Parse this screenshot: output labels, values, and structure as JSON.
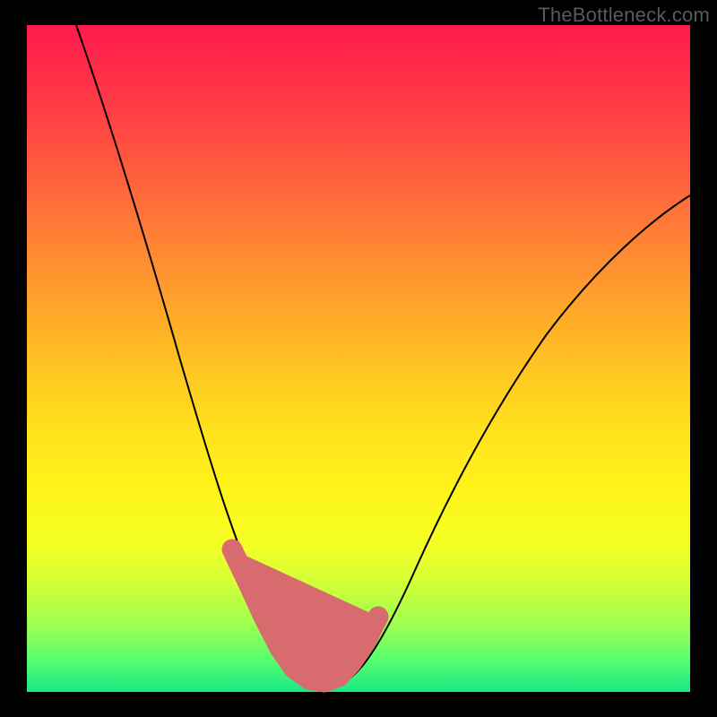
{
  "watermark": "TheBottleneck.com",
  "colors": {
    "frame_bg": "#000000",
    "curve": "#000000",
    "marker": "#d86b6e",
    "gradient_top": "#ff1a4d",
    "gradient_bottom": "#18e884"
  },
  "chart_data": {
    "type": "line",
    "title": "",
    "xlabel": "",
    "ylabel": "",
    "xlim": [
      0,
      100
    ],
    "ylim": [
      0,
      100
    ],
    "series": [
      {
        "name": "bottleneck-curve",
        "x": [
          0,
          5,
          10,
          15,
          20,
          25,
          30,
          33,
          36,
          38,
          40,
          43,
          46,
          50,
          55,
          60,
          65,
          70,
          75,
          80,
          85,
          90,
          95,
          100
        ],
        "y": [
          100,
          88,
          76,
          64,
          52,
          40,
          28,
          20,
          12,
          7,
          3,
          1,
          0,
          3,
          9,
          17,
          26,
          35,
          44,
          52,
          59,
          65,
          70,
          74
        ]
      }
    ],
    "marker_points": {
      "name": "highlighted-region",
      "x": [
        31,
        33,
        36,
        38,
        40,
        43,
        45,
        47,
        49,
        51,
        53
      ],
      "y": [
        22,
        18,
        11,
        7,
        4,
        2,
        1,
        2,
        4,
        7,
        11
      ]
    },
    "background": "vertical rainbow gradient red→orange→yellow→green"
  }
}
